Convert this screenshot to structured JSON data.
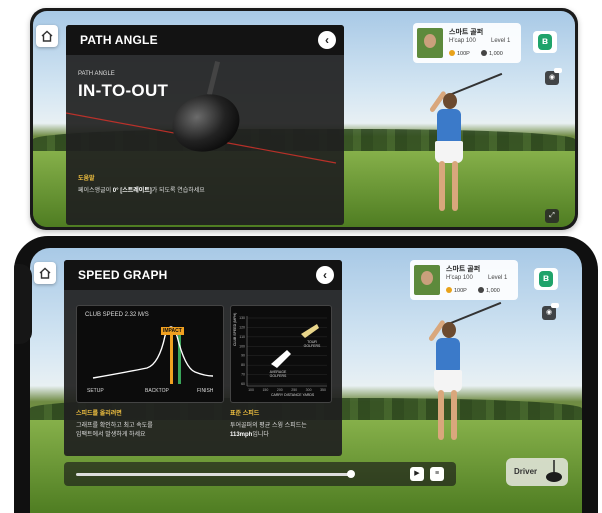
{
  "top_screen": {
    "panel": {
      "title": "PATH ANGLE",
      "close_icon": "chevron-left-icon",
      "small_label": "PATH ANGLE",
      "result": "IN-TO-OUT",
      "tip_title": "도움말",
      "tip_text_pre": "페이스앵글이 ",
      "tip_text_bold": "0° [스트레이트]",
      "tip_text_post": "가 되도록 연습하세요"
    },
    "profile": {
      "name": "스마트 골퍼",
      "hcap": "H'cap 100",
      "level": "Level 1",
      "points": "100P",
      "cash": "1,000"
    }
  },
  "bottom_screen": {
    "panel": {
      "title": "SPEED GRAPH",
      "close_icon": "chevron-left-icon",
      "club_speed": "CLUB SPEED 2.32 M/S",
      "impact_label": "IMPACT",
      "x_labels": [
        "SETUP",
        "BACKTOP",
        "FINISH"
      ],
      "scatter_ylabel": "CLUB SPEED (MPH)",
      "scatter_xlabel": "CARRY DISTANCE  YARDS",
      "scatter_yticks": [
        "130",
        "120",
        "110",
        "100",
        "90",
        "80",
        "70",
        "60"
      ],
      "scatter_xticks": [
        "100",
        "150",
        "200",
        "250",
        "300",
        "350"
      ],
      "zone_labels": [
        "AVERAGE GOLFERS",
        "TOUR GOLFERS"
      ],
      "left_tip_title": "스피드를 올리려면",
      "left_tip_line1": "그래프를 확인하고 최고 속도를",
      "left_tip_line2": "임팩트에서 발생하게 하세요",
      "right_tip_title": "표준 스피드",
      "right_tip_line1": "투어골퍼의 평균 스윙 스피드는",
      "right_tip_bold": "113mph",
      "right_tip_post": "입니다"
    },
    "profile": {
      "name": "스마트 골퍼",
      "hcap": "H'cap 100",
      "level": "Level 1",
      "points": "100P",
      "cash": "1,000"
    },
    "playback": {
      "progress": 0.86,
      "play_icon": "play-icon",
      "list_icon": "list-icon"
    },
    "driver_button": {
      "label": "Driver",
      "icon": "golf-driver-icon"
    }
  },
  "colors": {
    "accent_green": "#1fa36a",
    "impact_orange": "#f0a020",
    "tip_yellow": "#f0c040",
    "path_line_red": "#d2322a"
  }
}
